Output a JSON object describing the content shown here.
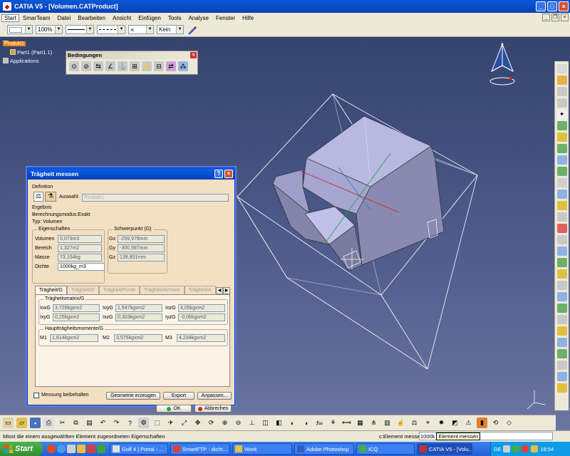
{
  "window": {
    "title": "CATIA V5 - [Volumen.CATProduct]"
  },
  "menu": [
    "Start",
    "SmarTeam",
    "Datei",
    "Bearbeiten",
    "Ansicht",
    "Einfügen",
    "Tools",
    "Analyse",
    "Fenster",
    "Hilfe"
  ],
  "toolbar": {
    "zoom": "100%",
    "layer": "Kein"
  },
  "tree": {
    "root": "Produkt1",
    "child": "Part1 (Part1.1)",
    "apps": "Applications"
  },
  "bedingungen": {
    "title": "Bedingungen"
  },
  "dialog": {
    "title": "Trägheit messen",
    "definition": "Definition",
    "auswahl_label": "Auswahl:",
    "auswahl_value": "Produkt1",
    "ergebnis": "Ergebnis",
    "modus": "Berechnungsmodus:Exakt",
    "typ": "Typ: Volumen",
    "eigenschaften": "Eigenschaften",
    "schwerpunkt": "Schwerpunkt (G)",
    "props": [
      {
        "label": "Volumen",
        "value": "0,073m3"
      },
      {
        "label": "Bereich",
        "value": "1,327m2"
      },
      {
        "label": "Masse",
        "value": "73,104kg"
      },
      {
        "label": "Dichte",
        "value": "1000kg_m3"
      }
    ],
    "cog": [
      {
        "label": "Gx",
        "value": "-259,976mm"
      },
      {
        "label": "Gy",
        "value": "-300,997mm"
      },
      {
        "label": "Gz",
        "value": "139,801mm"
      }
    ],
    "tabs": [
      "Trägheit/G",
      "Trägheit/O",
      "Trägheit/Punkt",
      "Trägheit/Achsen",
      "Trägheit/A"
    ],
    "matrix_title": "Trägheitsmatrix/G",
    "matrix": [
      [
        {
          "label": "IoxG",
          "value": "3,726kgxm2"
        },
        {
          "label": "IoyG",
          "value": "1,647kgxm2"
        },
        {
          "label": "IozG",
          "value": "4,05kgxm2"
        }
      ],
      [
        {
          "label": "IxyG",
          "value": "0,25kgxm2"
        },
        {
          "label": "IxzG",
          "value": "0,303kgxm2"
        },
        {
          "label": "IyzG",
          "value": "-0,06kgxm2"
        }
      ]
    ],
    "haupt_title": "Hauptträgheitsmomente/G",
    "haupt": [
      {
        "label": "M1",
        "value": "1,614kgxm2"
      },
      {
        "label": "M2",
        "value": "3,575kgxm2"
      },
      {
        "label": "M3",
        "value": "4,234kgxm2"
      }
    ],
    "keep_label": "Messung beibehalten",
    "btn_geom": "Geometrie erzeugen",
    "btn_export": "Export",
    "btn_custom": "Anpassen...",
    "btn_ok": "OK",
    "btn_cancel": "Abbrechen"
  },
  "status": {
    "message": "Misst die einem ausgewählten Element zugeordneten Eigenschaften",
    "cmd_label": "c:Element messen",
    "cmd_value": "1000k",
    "tooltip": "Element messen"
  },
  "taskbar": {
    "start": "Start",
    "tasks": [
      "Golf 4 | Portal - ...",
      "SmartFTP - dicht...",
      "Work",
      "Adobe Photoshop",
      "ICQ",
      "CATIA V5 - [Volu..."
    ],
    "lang": "DE",
    "clock": "18:54"
  },
  "colors": {
    "accent": "#0a58d8",
    "dialog_bg": "#f3dfc1",
    "viewport": "#4a5686",
    "tree_highlight": "#f08000"
  }
}
